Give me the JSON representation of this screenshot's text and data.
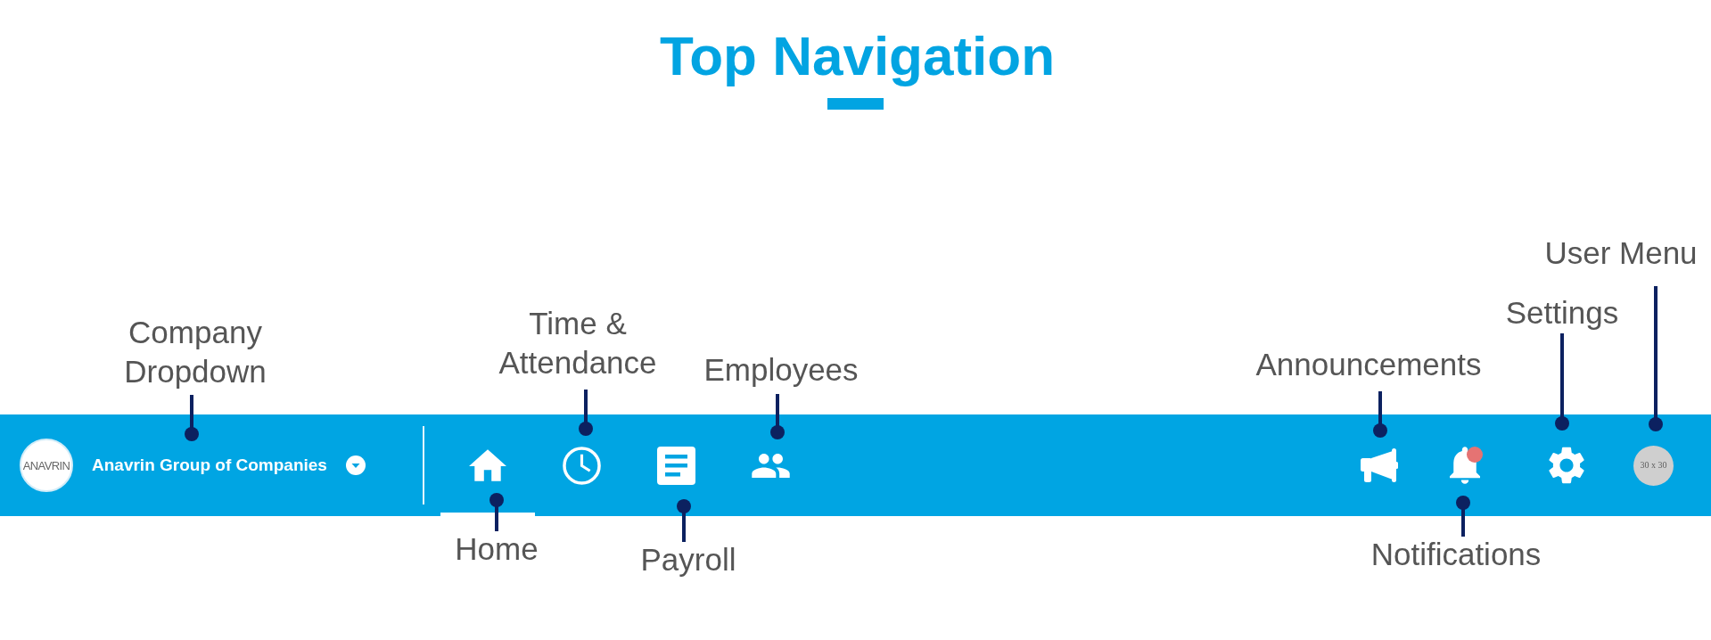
{
  "title": "Top Navigation",
  "nav_bar": {
    "company": {
      "logo_text": "ANAVRIN",
      "name": "Anavrin Group of Companies"
    },
    "tabs": [
      {
        "kind": "home",
        "selected": true
      },
      {
        "kind": "clock",
        "selected": false
      },
      {
        "kind": "document",
        "selected": false
      },
      {
        "kind": "people",
        "selected": false
      }
    ],
    "actions": [
      {
        "kind": "megaphone"
      },
      {
        "kind": "bell",
        "unread": true
      },
      {
        "kind": "gear"
      },
      {
        "kind": "avatar",
        "text": "30 x 30"
      }
    ]
  },
  "callouts": [
    {
      "label": "User Menu"
    },
    {
      "label": "Settings"
    },
    {
      "label": "Company Dropdown"
    },
    {
      "label": "Time & Attendance"
    },
    {
      "label": "Employees"
    },
    {
      "label": "Announcements"
    },
    {
      "label": "Home"
    },
    {
      "label": "Payroll"
    },
    {
      "label": "Notifications"
    }
  ]
}
